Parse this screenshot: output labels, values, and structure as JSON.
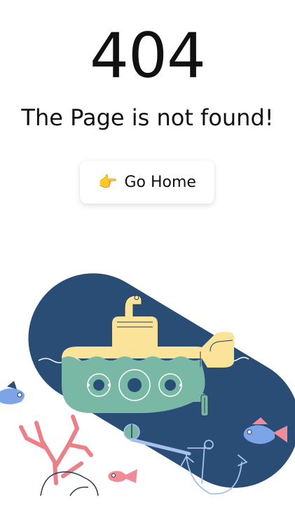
{
  "error": {
    "code": "404",
    "message": "The Page is not found!"
  },
  "actions": {
    "home_icon": "backhand-index-pointing-right-icon",
    "home_icon_glyph": "👉",
    "home_label": "Go Home"
  },
  "colors": {
    "navy": "#2a4d76",
    "submarine_body": "#7ab8a6",
    "submarine_top": "#fbe49a",
    "fish_blue": "#7ea4e8",
    "fish_pink": "#f08b97",
    "coral": "#ec8088",
    "line_dark": "#2a3a55",
    "line_light": "#a8c1ec"
  }
}
